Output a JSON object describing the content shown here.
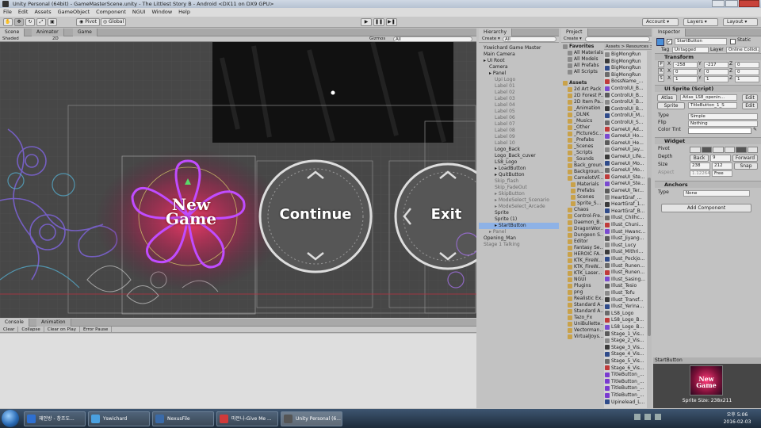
{
  "window": {
    "title": "Unity Personal (64bit) - GameMasterScene.unity - The Littlest Story B - Android <DX11 on DX9 GPU>"
  },
  "menu": [
    "File",
    "Edit",
    "Assets",
    "GameObject",
    "Component",
    "NGUI",
    "Window",
    "Help"
  ],
  "toolbar": {
    "pivot": "Pivot",
    "global": "Global",
    "account": "Account",
    "layers": "Layers",
    "layout": "Layout"
  },
  "scene_view": {
    "tabs": [
      "Scene",
      "Animator",
      "Game"
    ],
    "shading": "Shaded",
    "mode": "2D",
    "gizmos": "Gizmos",
    "search_placeholder": "All",
    "buttons": [
      "New\nGame",
      "Continue",
      "Exit"
    ]
  },
  "hierarchy": {
    "tab": "Hierarchy",
    "create": "Create",
    "search_placeholder": "All",
    "items": [
      {
        "label": "Yswichard Game Master",
        "indent": 0,
        "arrow": false,
        "dim": false
      },
      {
        "label": "Main Camera",
        "indent": 0,
        "arrow": false,
        "dim": false
      },
      {
        "label": "UI Root",
        "indent": 0,
        "arrow": true,
        "dim": false
      },
      {
        "label": "Camera",
        "indent": 1,
        "arrow": false,
        "dim": false
      },
      {
        "label": "Panel",
        "indent": 1,
        "arrow": true,
        "dim": false
      },
      {
        "label": "Upi Logo",
        "indent": 2,
        "arrow": false,
        "dim": true
      },
      {
        "label": "Label 01",
        "indent": 2,
        "arrow": false,
        "dim": true
      },
      {
        "label": "Label 02",
        "indent": 2,
        "arrow": false,
        "dim": true
      },
      {
        "label": "Label 03",
        "indent": 2,
        "arrow": false,
        "dim": true
      },
      {
        "label": "Label 04",
        "indent": 2,
        "arrow": false,
        "dim": true
      },
      {
        "label": "Label 05",
        "indent": 2,
        "arrow": false,
        "dim": true
      },
      {
        "label": "Label 06",
        "indent": 2,
        "arrow": false,
        "dim": true
      },
      {
        "label": "Label 07",
        "indent": 2,
        "arrow": false,
        "dim": true
      },
      {
        "label": "Label 08",
        "indent": 2,
        "arrow": false,
        "dim": true
      },
      {
        "label": "Label 09",
        "indent": 2,
        "arrow": false,
        "dim": true
      },
      {
        "label": "Label 10",
        "indent": 2,
        "arrow": false,
        "dim": true
      },
      {
        "label": "Logo_Back",
        "indent": 2,
        "arrow": false,
        "dim": false
      },
      {
        "label": "Logo_Back_cuver",
        "indent": 2,
        "arrow": false,
        "dim": false
      },
      {
        "label": "LS8_Logo",
        "indent": 2,
        "arrow": false,
        "dim": false
      },
      {
        "label": "LoadButton",
        "indent": 2,
        "arrow": true,
        "dim": false
      },
      {
        "label": "QuitButton",
        "indent": 2,
        "arrow": true,
        "dim": false
      },
      {
        "label": "Skip_flash",
        "indent": 2,
        "arrow": false,
        "dim": true
      },
      {
        "label": "Skip_FadeOut",
        "indent": 2,
        "arrow": false,
        "dim": true
      },
      {
        "label": "SkipButton",
        "indent": 2,
        "arrow": true,
        "dim": true
      },
      {
        "label": "ModeSelect_Scenario",
        "indent": 2,
        "arrow": true,
        "dim": true
      },
      {
        "label": "ModeSelect_Arcade",
        "indent": 2,
        "arrow": true,
        "dim": true
      },
      {
        "label": "Sprite",
        "indent": 2,
        "arrow": false,
        "dim": false
      },
      {
        "label": "Sprite (1)",
        "indent": 2,
        "arrow": false,
        "dim": false
      },
      {
        "label": "StartButton",
        "indent": 2,
        "arrow": true,
        "dim": false,
        "selected": true
      },
      {
        "label": "Panel",
        "indent": 1,
        "arrow": true,
        "dim": true
      },
      {
        "label": "Opening_Man",
        "indent": 0,
        "arrow": false,
        "dim": false
      },
      {
        "label": "Stage 1 Talking",
        "indent": 0,
        "arrow": false,
        "dim": true
      }
    ]
  },
  "project": {
    "tab": "Project",
    "create": "Create",
    "breadcrumb": "Assets > Resources > PicturesSc...",
    "favorites_label": "Favorites",
    "favorites": [
      "All Materials",
      "All Models",
      "All Prefabs",
      "All Scripts"
    ],
    "assets_label": "Assets",
    "folders": [
      "2d Art Pack",
      "2D Forest P...",
      "2D Item Pa...",
      "_Animation",
      "_DLNK",
      "_Musics",
      "_Other",
      "_PictureSc...",
      "_Prefabs",
      "_Scenes",
      "_Scripts",
      "_Sounds",
      "Back_groun...",
      "Backgroun...",
      "CamelotVF...",
      "Materials",
      "Prefabs",
      "Scenes",
      "Sprite_S...",
      "Chaos",
      "Control-Fre...",
      "Daemon_B...",
      "DragonWor...",
      "Dungeon S...",
      "Editor",
      "Fantasy Se...",
      "HEROIC FA...",
      "KTK_FireW...",
      "KTK_FireW...",
      "KTK_Laser...",
      "NGUI",
      "Plugins",
      "png",
      "Realistic Ex...",
      "Standard A...",
      "Standard A...",
      "Tazo_Fx",
      "UniBullette...",
      "Vectorman...",
      "VirtualJoys..."
    ],
    "files": [
      "BigMongRun",
      "BigMongRun",
      "BigMongRun",
      "BigMongRun",
      "BossName_...",
      "ControlUI_B...",
      "ControlUI_B...",
      "ControlUI_B...",
      "ControlUI_B...",
      "ControlUI_M...",
      "ControlUI_S...",
      "GameUI_Ad...",
      "GameUI_Ho...",
      "GameUI_He...",
      "GameUI_Jay...",
      "GameUI_Life...",
      "GameUI_Mo...",
      "GameUI_Mo...",
      "GameUI_Ste...",
      "GameUI_Ste...",
      "GameUI_Ter...",
      "HeartGraf_...",
      "HeartGraf_1...",
      "HeartGraf_B...",
      "Illust_Chilhc...",
      "Illust_Chuni...",
      "Illust_Hwanc...",
      "Illust_Jiyang...",
      "Illust_Lucy",
      "Illust_Mithri...",
      "Illust_Pockjo...",
      "Illust_Runen...",
      "Illust_Runen...",
      "Illust_Sasing...",
      "Illust_Tesio",
      "Illust_Tofu",
      "Illust_Transf...",
      "Illust_Yerina...",
      "LS8_Logo",
      "LS8_Logo_B...",
      "LS8_Logo_B...",
      "Stage_1_Vis...",
      "Stage_2_Vis...",
      "Stage_3_Vis...",
      "Stage_4_Vis...",
      "Stage_5_Vis...",
      "Stage_6_Vis...",
      "TitleButton_...",
      "TitleButton_...",
      "TitleButton_...",
      "TitleButton_...",
      "Upinelead_L..."
    ]
  },
  "inspector": {
    "tab": "Inspector",
    "object_name": "StartButton",
    "static": "Static",
    "tag_label": "Tag",
    "tag": "Untagged",
    "layer_label": "Layer",
    "layer": "Online Collidi...",
    "transform": {
      "title": "Transform",
      "p_label": "P",
      "r_label": "R",
      "s_label": "S",
      "p": [
        "-258",
        "-217",
        "0"
      ],
      "r": [
        "0",
        "0",
        "0"
      ],
      "s": [
        "1",
        "1",
        "1"
      ]
    },
    "sprite": {
      "title": "UI Sprite (Script)",
      "atlas_label": "Atlas",
      "atlas": "Atlas_LS8_openin...",
      "sprite_label": "Sprite",
      "sprite": "TitleButton_1_S",
      "edit": "Edit",
      "type_label": "Type",
      "type": "Simple",
      "flip_label": "Flip",
      "flip": "Nothing",
      "tint_label": "Color Tint"
    },
    "widget": {
      "title": "Widget",
      "pivot_label": "Pivot",
      "depth_label": "Depth",
      "back": "Back",
      "depth": "9",
      "forward": "Forward",
      "size_label": "Size",
      "w": "238",
      "h": "212",
      "snap": "Snap",
      "aspect_label": "Aspect",
      "aspect": "1.12264",
      "aspect_mode": "Free"
    },
    "anchors": {
      "title": "Anchors",
      "type_label": "Type",
      "type": "None"
    },
    "add_component": "Add Component",
    "preview_title": "StartButton",
    "preview_caption": "Sprite Size: 238x211"
  },
  "console": {
    "tabs": [
      "Console",
      "Animation"
    ],
    "buttons": [
      "Clear",
      "Collapse",
      "Clear on Play",
      "Error Pause"
    ]
  },
  "taskbar": {
    "items": [
      "재인방 - 창조도...",
      "Yswichard",
      "NexusFile",
      "마돈나-Give Me ...",
      "Unity Personal (6..."
    ],
    "time": "오후 5:06",
    "date": "2016-02-03"
  }
}
